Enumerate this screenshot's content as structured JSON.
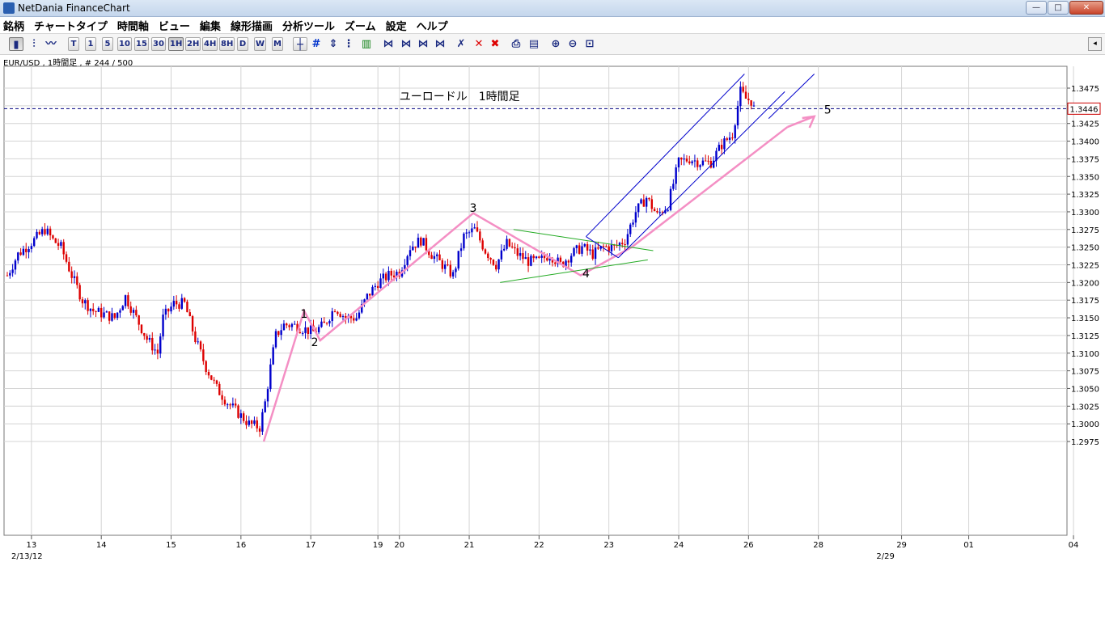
{
  "window": {
    "title": "NetDania FinanceChart",
    "minimize_label": "—",
    "maximize_label": "□",
    "close_label": "✕"
  },
  "menu": {
    "items": [
      "銘柄",
      "チャートタイプ",
      "時間軸",
      "ビュー",
      "編集",
      "線形描画",
      "分析ツール",
      "ズーム",
      "設定",
      "ヘルプ"
    ]
  },
  "toolbar": {
    "chart_types": [
      "candlestick-icon",
      "bar-chart-icon",
      "line-chart-icon"
    ],
    "timeframes": [
      "T",
      "1",
      "5",
      "10",
      "15",
      "30",
      "1H",
      "2H",
      "4H",
      "8H",
      "D",
      "W",
      "M"
    ],
    "active_timeframe": "1H",
    "drawing_tools": [
      "crosshair-icon",
      "grid-icon",
      "scale-icon",
      "indicator-icon",
      "volume-icon",
      "trendline-icon",
      "channel-icon",
      "fibonacci-icon",
      "gann-icon",
      "cycle-icon",
      "delete-selected-icon",
      "delete-all-icon",
      "print-icon",
      "export-icon",
      "zoom-in-icon",
      "zoom-out-icon",
      "zoom-reset-icon"
    ],
    "scroll_label": "◂"
  },
  "info_line": "EUR/USD , 1時間足 , # 244 / 500",
  "colors": {
    "bull": "#0000cc",
    "bear": "#dd0000",
    "waves": "#f48fc4",
    "triangle": "#22aa22",
    "channel": "#0000cc",
    "price_line": "#000080",
    "price_label_border": "#cc0000"
  },
  "chart_data": {
    "type": "candlestick",
    "title": "ユーロードル　1時間足",
    "symbol": "EUR/USD",
    "timeframe": "1時間足",
    "ylim": [
      2.9725,
      1.35
    ],
    "y_ticks": [
      1.2975,
      1.3,
      1.3025,
      1.305,
      1.3075,
      1.31,
      1.3125,
      1.315,
      1.3175,
      1.32,
      1.3225,
      1.325,
      1.3275,
      1.33,
      1.3325,
      1.335,
      1.3375,
      1.34,
      1.3425,
      1.345,
      1.3475
    ],
    "y_tick_labels": [
      "1.2975",
      "1.3000",
      "1.3025",
      "1.3050",
      "1.3075",
      "1.3100",
      "1.3125",
      "1.3150",
      "1.3175",
      "1.3200",
      "1.3225",
      "1.3250",
      "1.3275",
      "1.3300",
      "1.3325",
      "1.3350",
      "1.3375",
      "1.3400",
      "1.3425",
      "1.3450",
      "1.3475"
    ],
    "current_price": 1.3446,
    "current_price_label": "1.3446",
    "x_ticks": [
      {
        "i": 9,
        "label": "13"
      },
      {
        "i": 35,
        "label": "14"
      },
      {
        "i": 61,
        "label": "15"
      },
      {
        "i": 87,
        "label": "16"
      },
      {
        "i": 113,
        "label": "17"
      },
      {
        "i": 138,
        "label": "19"
      },
      {
        "i": 146,
        "label": "20"
      },
      {
        "i": 172,
        "label": "21"
      },
      {
        "i": 198,
        "label": "22"
      },
      {
        "i": 224,
        "label": "23"
      },
      {
        "i": 250,
        "label": "24"
      },
      {
        "i": 276,
        "label": "26"
      },
      {
        "i": 302,
        "label": "28"
      },
      {
        "i": 333,
        "label": "29"
      },
      {
        "i": 358,
        "label": "01"
      },
      {
        "i": 397,
        "label": "04"
      }
    ],
    "x_start_label": "2/13/12",
    "x_end_label": "2/29",
    "close_anchors": [
      [
        0,
        1.321
      ],
      [
        4,
        1.324
      ],
      [
        10,
        1.326
      ],
      [
        14,
        1.3275
      ],
      [
        17,
        1.326
      ],
      [
        20,
        1.325
      ],
      [
        24,
        1.321
      ],
      [
        28,
        1.3175
      ],
      [
        32,
        1.316
      ],
      [
        36,
        1.3155
      ],
      [
        40,
        1.315
      ],
      [
        44,
        1.318
      ],
      [
        48,
        1.315
      ],
      [
        52,
        1.312
      ],
      [
        56,
        1.31
      ],
      [
        58,
        1.315
      ],
      [
        62,
        1.317
      ],
      [
        66,
        1.317
      ],
      [
        70,
        1.312
      ],
      [
        74,
        1.308
      ],
      [
        78,
        1.305
      ],
      [
        82,
        1.303
      ],
      [
        86,
        1.3015
      ],
      [
        90,
        1.3
      ],
      [
        94,
        1.2995
      ],
      [
        96,
        1.303
      ],
      [
        98,
        1.308
      ],
      [
        100,
        1.3125
      ],
      [
        103,
        1.314
      ],
      [
        106,
        1.314
      ],
      [
        110,
        1.3135
      ],
      [
        114,
        1.313
      ],
      [
        118,
        1.314
      ],
      [
        122,
        1.3165
      ],
      [
        126,
        1.315
      ],
      [
        130,
        1.315
      ],
      [
        134,
        1.318
      ],
      [
        138,
        1.32
      ],
      [
        142,
        1.321
      ],
      [
        146,
        1.3215
      ],
      [
        150,
        1.325
      ],
      [
        154,
        1.326
      ],
      [
        158,
        1.324
      ],
      [
        162,
        1.3225
      ],
      [
        166,
        1.321
      ],
      [
        170,
        1.3265
      ],
      [
        174,
        1.3275
      ],
      [
        178,
        1.3245
      ],
      [
        182,
        1.3225
      ],
      [
        186,
        1.3255
      ],
      [
        190,
        1.324
      ],
      [
        194,
        1.323
      ],
      [
        198,
        1.323
      ],
      [
        202,
        1.324
      ],
      [
        206,
        1.3225
      ],
      [
        210,
        1.324
      ],
      [
        214,
        1.325
      ],
      [
        218,
        1.324
      ],
      [
        222,
        1.325
      ],
      [
        226,
        1.325
      ],
      [
        230,
        1.326
      ],
      [
        234,
        1.33
      ],
      [
        238,
        1.332
      ],
      [
        242,
        1.3295
      ],
      [
        246,
        1.331
      ],
      [
        250,
        1.337
      ],
      [
        254,
        1.3375
      ],
      [
        258,
        1.337
      ],
      [
        262,
        1.337
      ],
      [
        266,
        1.3395
      ],
      [
        270,
        1.341
      ],
      [
        273,
        1.347
      ],
      [
        275,
        1.346
      ],
      [
        277,
        1.3457
      ],
      [
        278,
        1.3446
      ]
    ],
    "candle_count": 279,
    "wave_labels": [
      {
        "label": "1",
        "i": 110.5,
        "price": 1.315
      },
      {
        "label": "2",
        "i": 114.5,
        "price": 1.311
      },
      {
        "label": "3",
        "i": 173.5,
        "price": 1.33
      },
      {
        "label": "4",
        "i": 215.5,
        "price": 1.3207
      },
      {
        "label": "5",
        "i": 305.5,
        "price": 1.3439
      }
    ],
    "wave_path": [
      [
        95.5,
        1.2975
      ],
      [
        110.5,
        1.316
      ],
      [
        116.5,
        1.3118
      ],
      [
        173.5,
        1.3298
      ],
      [
        213.5,
        1.321
      ],
      [
        232.5,
        1.325
      ],
      [
        290.5,
        1.342
      ]
    ],
    "triangle_upper": [
      [
        188.5,
        1.3275
      ],
      [
        240.5,
        1.3245
      ]
    ],
    "triangle_lower": [
      [
        183.5,
        1.32
      ],
      [
        238.5,
        1.3232
      ]
    ],
    "channel_lines": [
      [
        [
          215.5,
          1.3265
        ],
        [
          274.5,
          1.3495
        ]
      ],
      [
        [
          227.5,
          1.3235
        ],
        [
          289.5,
          1.347
        ]
      ],
      [
        [
          283.5,
          1.3432
        ],
        [
          300.5,
          1.3495
        ]
      ]
    ],
    "wave_arrow_head": [
      300.5,
      1.3435
    ]
  }
}
